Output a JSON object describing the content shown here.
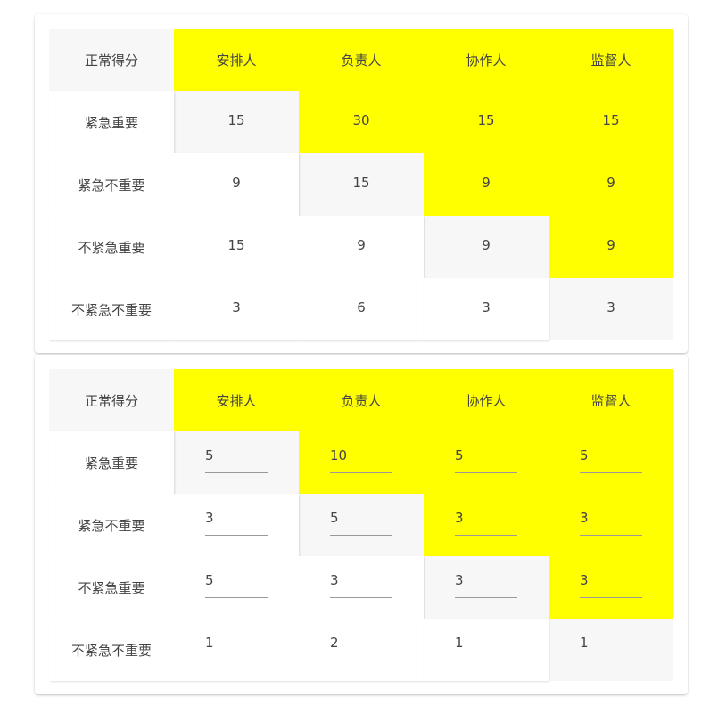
{
  "table1": {
    "corner": "正常得分",
    "columns": [
      "安排人",
      "负责人",
      "协作人",
      "监督人"
    ],
    "rows": [
      {
        "label": "紧急重要",
        "values": [
          "15",
          "30",
          "15",
          "15"
        ]
      },
      {
        "label": "紧急不重要",
        "values": [
          "9",
          "15",
          "9",
          "9"
        ]
      },
      {
        "label": "不紧急重要",
        "values": [
          "15",
          "9",
          "9",
          "9"
        ]
      },
      {
        "label": "不紧急不重要",
        "values": [
          "3",
          "6",
          "3",
          "3"
        ]
      }
    ]
  },
  "table2": {
    "corner": "正常得分",
    "columns": [
      "安排人",
      "负责人",
      "协作人",
      "监督人"
    ],
    "rows": [
      {
        "label": "紧急重要",
        "values": [
          "5",
          "10",
          "5",
          "5"
        ]
      },
      {
        "label": "紧急不重要",
        "values": [
          "3",
          "5",
          "3",
          "3"
        ]
      },
      {
        "label": "不紧急重要",
        "values": [
          "5",
          "3",
          "3",
          "3"
        ]
      },
      {
        "label": "不紧急不重要",
        "values": [
          "1",
          "2",
          "1",
          "1"
        ]
      }
    ]
  },
  "colors": {
    "highlight": "#ffff00",
    "diagonal": "#f7f7f7",
    "cell": "#ffffff"
  }
}
